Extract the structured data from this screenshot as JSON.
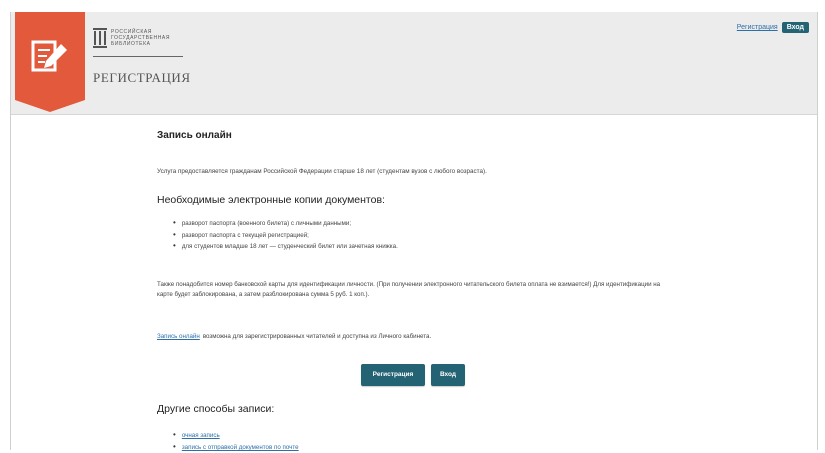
{
  "header": {
    "library_name_lines": [
      "РОССИЙСКАЯ",
      "ГОСУДАРСТВЕННАЯ",
      "БИБЛИОТЕКА"
    ],
    "section_title": "РЕГИСТРАЦИЯ",
    "register_link": "Регистрация",
    "login_button": "Вход"
  },
  "main": {
    "title": "Запись онлайн",
    "intro": "Услуга предоставляется гражданам Российской Федерации старше 18 лет (студентам вузов с любого возраста).",
    "docs_heading": "Необходимые электронные копии документов:",
    "docs": [
      "разворот паспорта (военного билета) с личными данными;",
      "разворот паспорта с текущей регистрацией;",
      "для студентов младше 18 лет — студенческий билет или зачетная книжка."
    ],
    "note": "Также понадобится номер банковской карты для идентификации личности. (При получении электронного читательского билета оплата не взимается!) Для идентификации на карте будет заблокирована, а затем разблокирована сумма 5 руб. 1 коп.).",
    "online_link": "Запись онлайн",
    "online_text": "возможна для зарегистрированных читателей и доступна из Личного кабинета.",
    "register_button": "Регистрация",
    "login_button": "Вход",
    "other_heading": "Другие способы записи:",
    "other_links": [
      "очная запись",
      "запись с отправкой документов по почте"
    ]
  },
  "colors": {
    "accent": "#e2593c",
    "button": "#246374",
    "link": "#2d6fa8"
  }
}
